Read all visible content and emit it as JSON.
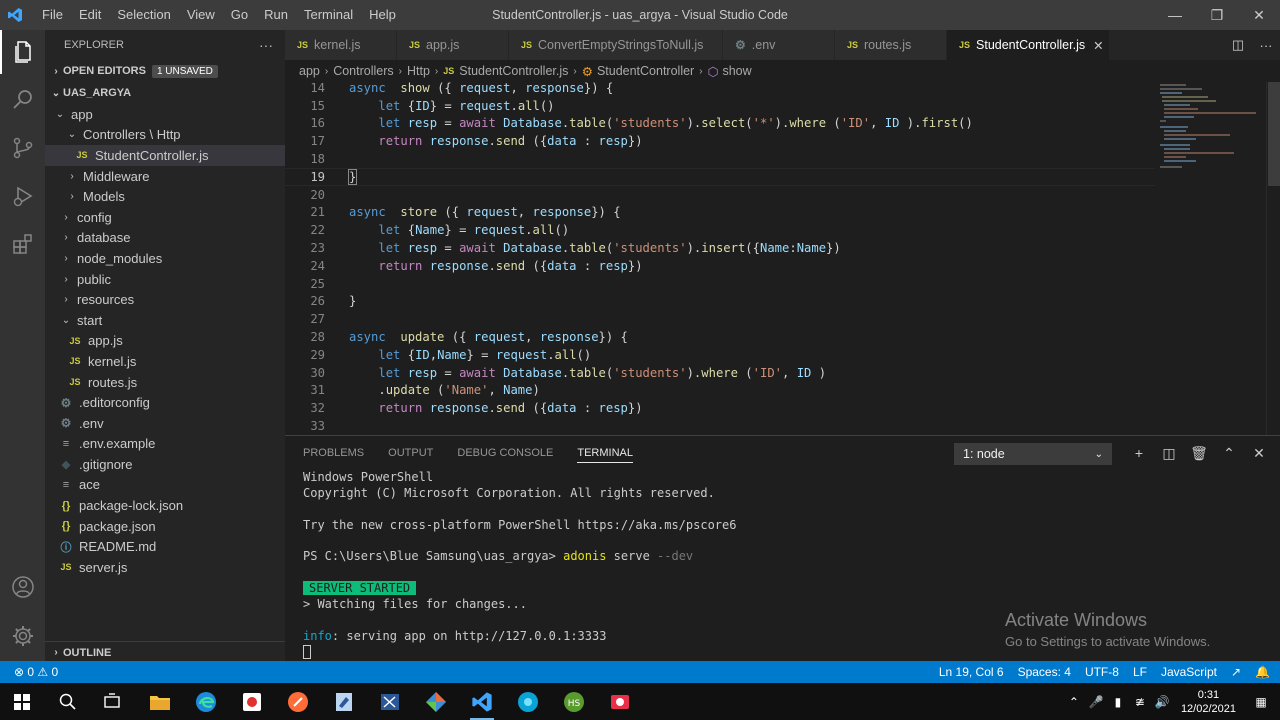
{
  "window": {
    "title": "StudentController.js - uas_argya - Visual Studio Code",
    "menu": [
      "File",
      "Edit",
      "Selection",
      "View",
      "Go",
      "Run",
      "Terminal",
      "Help"
    ]
  },
  "sidebar": {
    "explorer_label": "EXPLORER",
    "more": "···",
    "open_editors": "OPEN EDITORS",
    "unsaved_badge": "1 UNSAVED",
    "project": "UAS_ARGYA",
    "tree": [
      {
        "label": "app",
        "chev": "⌄"
      },
      {
        "label": "Controllers \\ Http",
        "chev": "⌄"
      },
      {
        "label": "StudentController.js",
        "icon": "JS"
      },
      {
        "label": "Middleware",
        "chev": "›"
      },
      {
        "label": "Models",
        "chev": "›"
      },
      {
        "label": "config",
        "chev": "›"
      },
      {
        "label": "database",
        "chev": "›"
      },
      {
        "label": "node_modules",
        "chev": "›"
      },
      {
        "label": "public",
        "chev": "›"
      },
      {
        "label": "resources",
        "chev": "›"
      },
      {
        "label": "start",
        "chev": "⌄"
      },
      {
        "label": "app.js",
        "icon": "JS"
      },
      {
        "label": "kernel.js",
        "icon": "JS"
      },
      {
        "label": "routes.js",
        "icon": "JS"
      },
      {
        "label": ".editorconfig",
        "icon": "⚙"
      },
      {
        "label": ".env",
        "icon": "⚙"
      },
      {
        "label": ".env.example",
        "icon": "≡"
      },
      {
        "label": ".gitignore",
        "icon": "◆"
      },
      {
        "label": "ace",
        "icon": "≡"
      },
      {
        "label": "package-lock.json",
        "icon": "{}"
      },
      {
        "label": "package.json",
        "icon": "{}"
      },
      {
        "label": "README.md",
        "icon": "ⓘ"
      },
      {
        "label": "server.js",
        "icon": "JS"
      }
    ],
    "outline": "OUTLINE"
  },
  "tabs": [
    {
      "label": "kernel.js",
      "icon": "JS"
    },
    {
      "label": "app.js",
      "icon": "JS"
    },
    {
      "label": "ConvertEmptyStringsToNull.js",
      "icon": "JS"
    },
    {
      "label": ".env",
      "icon": "⚙"
    },
    {
      "label": "routes.js",
      "icon": "JS"
    },
    {
      "label": "StudentController.js",
      "icon": "JS"
    }
  ],
  "breadcrumb": {
    "parts": [
      "app",
      "Controllers",
      "Http"
    ],
    "file": "StudentController.js",
    "class": "StudentController",
    "method": "show"
  },
  "editor": {
    "line_numbers": [
      "14",
      "15",
      "16",
      "17",
      "18",
      "19",
      "20",
      "21",
      "22",
      "23",
      "24",
      "25",
      "26",
      "27",
      "28",
      "29",
      "30",
      "31",
      "32",
      "33"
    ],
    "current_line": "19"
  },
  "panel": {
    "tabs": [
      "PROBLEMS",
      "OUTPUT",
      "DEBUG CONSOLE",
      "TERMINAL"
    ],
    "terminal_select": "1: node",
    "lines": {
      "l1": "Windows PowerShell",
      "l2": "Copyright (C) Microsoft Corporation. All rights reserved.",
      "l3": "Try the new cross-platform PowerShell https://aka.ms/pscore6",
      "prompt": "PS C:\\Users\\Blue Samsung\\uas_argya> ",
      "cmd": "adonis",
      "cmd_arg": " serve ",
      "cmd_flag": "--dev",
      "server": "SERVER STARTED",
      "watch": "> Watching files for changes...",
      "info_label": "info",
      "info_text": ": serving app on http://127.0.0.1:3333"
    },
    "activate_title": "Activate Windows",
    "activate_sub": "Go to Settings to activate Windows."
  },
  "statusbar": {
    "errors": "⊗ 0 ⚠ 0",
    "position": "Ln 19, Col 6",
    "spaces": "Spaces: 4",
    "encoding": "UTF-8",
    "eol": "LF",
    "language": "JavaScript"
  },
  "taskbar": {
    "time": "0:31",
    "date": "12/02/2021"
  }
}
